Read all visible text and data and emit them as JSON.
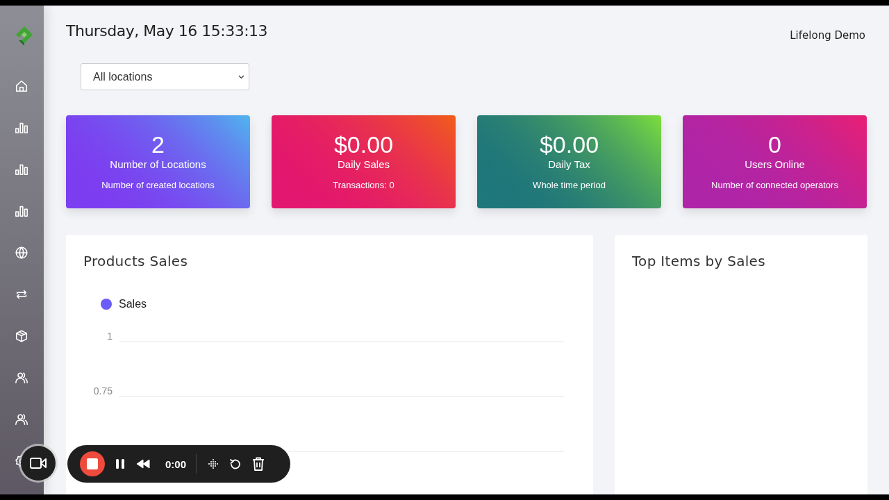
{
  "sidebar": {
    "items": [
      {
        "kind": "home"
      },
      {
        "kind": "bars"
      },
      {
        "kind": "bars"
      },
      {
        "kind": "bars"
      },
      {
        "kind": "globe"
      },
      {
        "kind": "repeat"
      },
      {
        "kind": "box"
      },
      {
        "kind": "users"
      },
      {
        "kind": "users"
      },
      {
        "kind": "gear"
      }
    ]
  },
  "header": {
    "datetime": "Thursday, May 16 15:33:13",
    "user": "Lifelong Demo"
  },
  "location_select": {
    "value": "All locations"
  },
  "cards": [
    {
      "value": "2",
      "title": "Number of Locations",
      "subtitle": "Number of created locations",
      "color": "#7b3ff0"
    },
    {
      "value": "$0.00",
      "title": "Daily Sales",
      "subtitle": "Transactions: 0",
      "color": "#e3186f"
    },
    {
      "value": "$0.00",
      "title": "Daily Tax",
      "subtitle": "Whole time period",
      "color": "#1f7a7a"
    },
    {
      "value": "0",
      "title": "Users Online",
      "subtitle": "Number of connected operators",
      "color": "#b025a8"
    }
  ],
  "products_sales": {
    "title": "Products Sales",
    "chart_data": {
      "type": "line",
      "ylim": [
        0.5,
        1
      ],
      "yticks": [
        0.75,
        1
      ],
      "series": [
        {
          "name": "Sales",
          "color": "#6a5cf5",
          "values": [
            null
          ]
        }
      ]
    }
  },
  "top_items": {
    "title": "Top Items by Sales"
  },
  "recorder": {
    "time": "0:00"
  }
}
